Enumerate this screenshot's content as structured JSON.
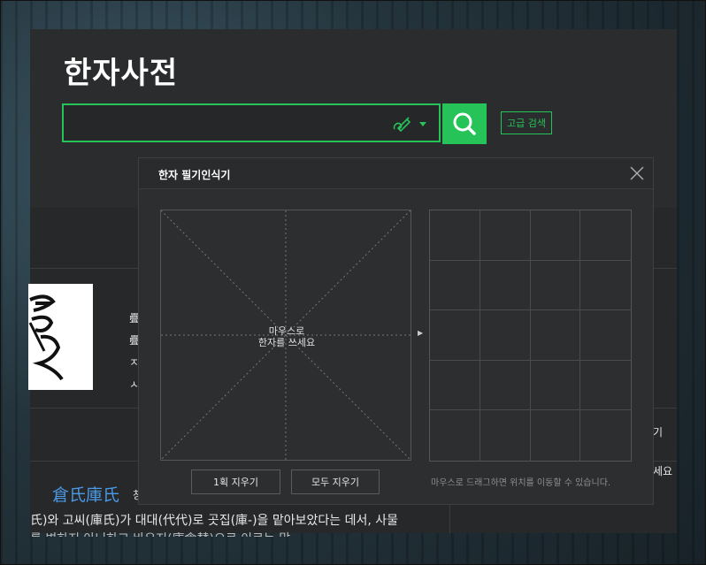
{
  "page": {
    "title": "한자사전"
  },
  "search": {
    "value": "",
    "placeholder": "",
    "advanced_label": "고급 검색"
  },
  "icons": {
    "handwriting": "pen-icon",
    "dropdown": "caret-down-icon",
    "search": "search-icon",
    "close": "close-icon"
  },
  "colors": {
    "accent": "#25c358",
    "link": "#4a9ae8",
    "panel": "#2a2b2d"
  },
  "popup": {
    "title": "한자 필기인식기",
    "draw_hint_line1": "마우스로",
    "draw_hint_line2": "한자를 쓰세요",
    "erase_one_label": "1획 지우기",
    "erase_all_label": "모두 지우기",
    "drag_hint": "마우스로 드래그하면 위치를 이동할 수 있습니다."
  },
  "result": {
    "word_title": "倉氏庫氏",
    "word_suffix": "창",
    "line1": "氏)와 고씨(庫氏)가 대대(代代)로 곳집(庫-)을 맡아보았다는 데서, 사물",
    "line2": "를 변하지 아니하고 바우지(庫倉替)으로 이르는 말",
    "side_chars": [
      ""
    ],
    "right_text1": "기",
    "right_text2": "세요"
  }
}
